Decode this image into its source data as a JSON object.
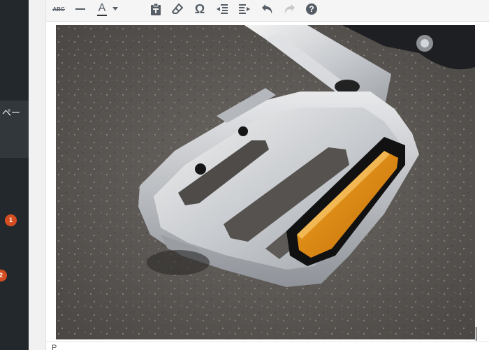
{
  "sidebar": {
    "menu_partial_label": "ペー",
    "badges": [
      "1",
      "2"
    ]
  },
  "toolbar": {
    "buttons": [
      {
        "name": "strikethrough-button",
        "icon": "strikethrough-icon",
        "glyph": "ABC"
      },
      {
        "name": "horizontal-line-button",
        "icon": "horizontal-line-icon"
      },
      {
        "name": "text-color-button",
        "icon": "text-color-icon",
        "glyph": "A"
      },
      {
        "name": "text-color-dropdown",
        "icon": "caret-down-icon"
      },
      {
        "name": "paste-as-text-button",
        "icon": "paste-icon"
      },
      {
        "name": "clear-formatting-button",
        "icon": "eraser-icon"
      },
      {
        "name": "special-character-button",
        "icon": "omega-icon",
        "glyph": "Ω"
      },
      {
        "name": "outdent-button",
        "icon": "outdent-icon"
      },
      {
        "name": "indent-button",
        "icon": "indent-icon"
      },
      {
        "name": "undo-button",
        "icon": "undo-icon"
      },
      {
        "name": "redo-button",
        "icon": "redo-icon",
        "disabled": true
      },
      {
        "name": "help-button",
        "icon": "help-icon",
        "glyph": "?"
      }
    ]
  },
  "content": {
    "image_subject": "bicycle-pedal-photo"
  },
  "statusbar": {
    "path": "P"
  },
  "colors": {
    "sidebar_bg": "#23282d",
    "badge": "#d54e21",
    "toolbar_icon": "#555d66",
    "reflector": "#e8920c"
  }
}
